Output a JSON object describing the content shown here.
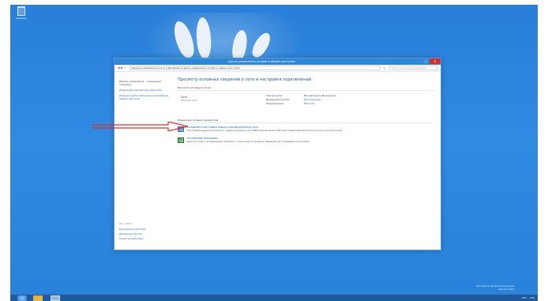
{
  "desktop": {
    "recycle_bin_label": "Корзина"
  },
  "window": {
    "title": "Центр управления сетями и общим доступом",
    "controls": {
      "minimize": "–",
      "maximize": "□",
      "close": "✕"
    },
    "address": {
      "back": "◀",
      "forward": "▶",
      "up": "↑",
      "breadcrumb": "Панель управления ▸ Сеть и Интернет ▸ Центр управления сетями и общим доступом",
      "refresh": "↻",
      "search_placeholder": "Поиск в панели управления",
      "search_icon": "⌕"
    },
    "sidebar": {
      "home_link": "Панель управления — домашняя страница",
      "links": [
        "Изменение параметров адаптера",
        "Изменить дополнительные параметры общего доступа"
      ],
      "see_also_caption": "См. также",
      "see_also_links": [
        "Брандмауэр Windows",
        "Домашняя группа",
        "Свойства браузера"
      ]
    },
    "main": {
      "heading": "Просмотр основных сведений о сети и настройка подключений",
      "active_networks_caption": "Просмотр активных сетей",
      "network": {
        "name": "Сеть",
        "type": "Частная сеть",
        "rows": [
          {
            "key": "Тип доступа:",
            "value": "Без доступа к Интернету"
          },
          {
            "key": "Домашняя группа:",
            "value": "Присоединен"
          },
          {
            "key": "Подключения:",
            "value": "Ethernet"
          }
        ]
      },
      "change_settings_caption": "Изменение сетевых параметров",
      "tasks": [
        {
          "title": "Создание и настройка нового подключения или сети",
          "desc": "Настройка широкополосного, коммутируемого или VPN-подключения либо настройка маршрутизатора или точки доступа."
        },
        {
          "title": "Устранение неполадок",
          "desc": "Диагностика и исправление проблем с сетью или получение сведений об устранении неполадок."
        }
      ]
    }
  },
  "watermark": {
    "line1": "Windows 8 Профессиональная",
    "line2": "Сборка 9200"
  },
  "taskbar": {
    "tray_lang": "РУС",
    "tray_time": "1:50"
  },
  "colors": {
    "desktop": "#2f86dc",
    "titlebar": "#2f86d6",
    "close": "#c7332b",
    "link": "#1b64b3",
    "arrow": "#d9302a"
  }
}
